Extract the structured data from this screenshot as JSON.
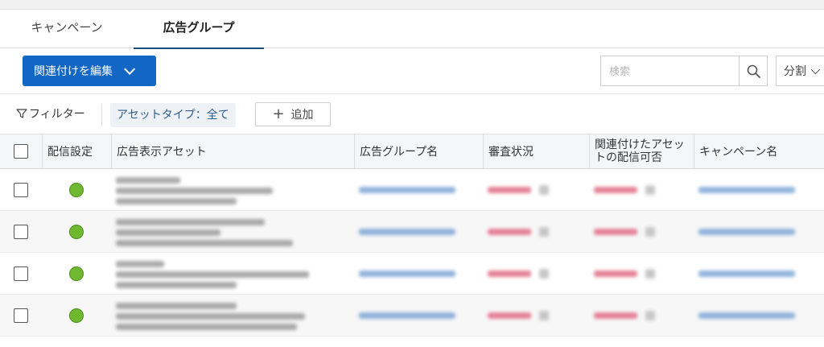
{
  "tabs": [
    {
      "label": "キャンペーン",
      "active": false
    },
    {
      "label": "広告グループ",
      "active": true
    }
  ],
  "toolbar": {
    "edit_button_label": "関連付けを編集",
    "search_placeholder": "検索",
    "split_label": "分割"
  },
  "filterbar": {
    "filter_label": "フィルター",
    "chip_label": "アセットタイプ：全て",
    "add_label": "追加"
  },
  "table": {
    "columns": [
      "配信設定",
      "広告表示アセット",
      "広告グループ名",
      "審査状況",
      "関連付けたアセットの配信可否",
      "キャンペーン名"
    ],
    "rows": [
      {
        "checked": false,
        "status": "active"
      },
      {
        "checked": false,
        "status": "active"
      },
      {
        "checked": false,
        "status": "active"
      },
      {
        "checked": false,
        "status": "active"
      }
    ]
  },
  "colors": {
    "accent": "#1266c4",
    "active_tab_underline": "#1a4d7a",
    "status_dot": "#6fb830",
    "chip_text": "#2c5e8f"
  },
  "icons": {
    "search": "search-icon",
    "filter": "filter-icon",
    "chevron": "chevron-down-icon",
    "plus": "plus-icon"
  }
}
